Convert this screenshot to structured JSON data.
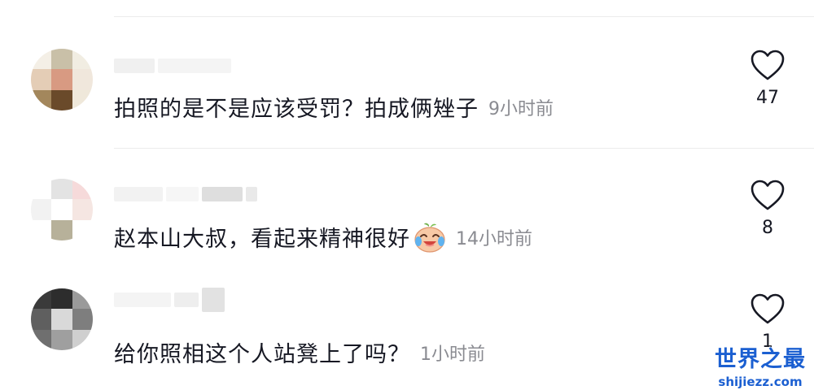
{
  "comments": [
    {
      "text": "拍照的是不是应该受罚？拍成俩矬子",
      "time": "9小时前",
      "likes": "47",
      "avatar_colors": [
        "#f4efe6",
        "#c9c0a8",
        "#f1ede2",
        "#e4cdb6",
        "#d89a82",
        "#f0e7dc",
        "#a3875c",
        "#6a4a2a",
        "#efe8da"
      ]
    },
    {
      "text": "赵本山大叔，看起来精神很好",
      "time": "14小时前",
      "likes": "8",
      "avatar_colors": [
        "#ffffff",
        "#e3e3e3",
        "#f6dada",
        "#f2f2f2",
        "#ffffff",
        "#f5e6e2",
        "#ffffff",
        "#b7b19a",
        "#ffffff"
      ]
    },
    {
      "text": "给你照相这个人站凳上了吗？",
      "time": "1小时前",
      "likes": "1",
      "avatar_colors": [
        "#3a3a3a",
        "#2d2d2d",
        "#9a9a9a",
        "#5f5f5f",
        "#d9d9d9",
        "#7e7e7e",
        "#6f6f6f",
        "#9f9f9f",
        "#cfcfcf"
      ]
    }
  ],
  "emoji": "crying-laughing-face",
  "watermark": {
    "title": "世界之最",
    "url": "shijiezz.com"
  },
  "colors": {
    "text": "#161823",
    "time": "#8a8b91",
    "divider": "#ececec",
    "watermark": "#1b5fd1"
  }
}
